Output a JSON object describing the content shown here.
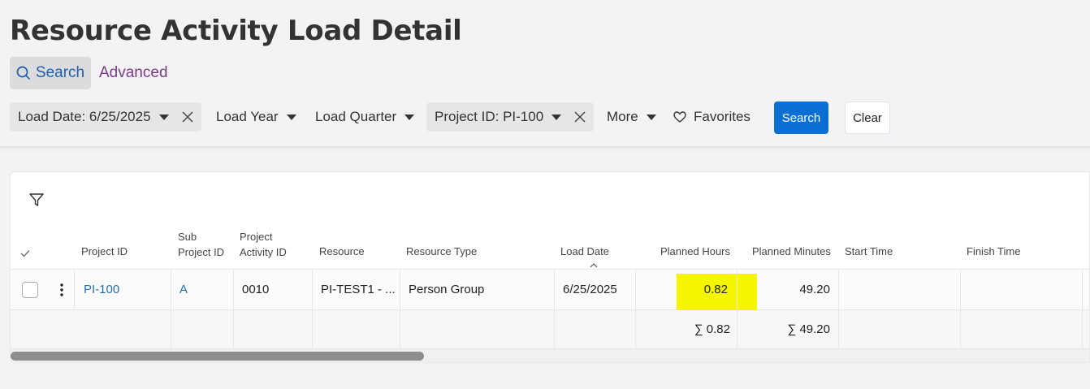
{
  "page": {
    "title": "Resource Activity Load Detail"
  },
  "modes": {
    "search": "Search",
    "advanced": "Advanced"
  },
  "filters": {
    "load_date": "Load Date: 6/25/2025",
    "load_year": "Load Year",
    "load_quarter": "Load Quarter",
    "project_id": "Project ID: PI-100",
    "more": "More",
    "favorites": "Favorites",
    "search_button": "Search",
    "clear_button": "Clear"
  },
  "table": {
    "headers": {
      "project_id": "Project ID",
      "sub_project_id_1": "Sub",
      "sub_project_id_2": "Project ID",
      "project_activity_id_1": "Project",
      "project_activity_id_2": "Activity ID",
      "resource": "Resource",
      "resource_type": "Resource Type",
      "load_date": "Load Date",
      "planned_hours": "Planned Hours",
      "planned_minutes": "Planned Minutes",
      "start_time": "Start Time",
      "finish_time": "Finish Time"
    },
    "rows": [
      {
        "project_id": "PI-100",
        "sub_project_id": "A",
        "project_activity_id": "0010",
        "resource": "PI-TEST1 - ...",
        "resource_type": "Person Group",
        "load_date": "6/25/2025",
        "planned_hours": "0.82",
        "planned_minutes": "49.20",
        "start_time": "",
        "finish_time": ""
      }
    ],
    "totals": {
      "planned_hours": "∑ 0.82",
      "planned_minutes": "∑ 49.20"
    }
  },
  "colors": {
    "accent": "#0a6fd3",
    "highlight": "#f5f500",
    "link": "#1f6fb5",
    "advanced": "#7a3c86"
  },
  "icons": [
    "search-icon",
    "caret-down-icon",
    "close-icon",
    "heart-icon",
    "funnel-icon",
    "checkmark-icon",
    "sort-asc-icon",
    "kebab-menu-icon"
  ]
}
